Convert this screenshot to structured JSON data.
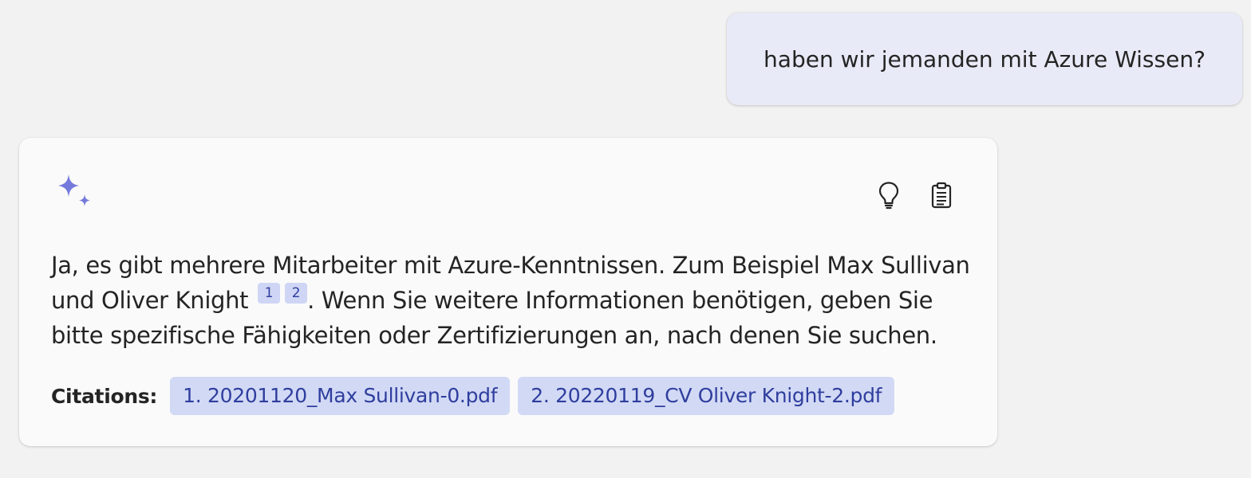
{
  "user_message": {
    "text": "haben wir jemanden mit Azure Wissen?"
  },
  "assistant_message": {
    "text_part1": "Ja, es gibt mehrere Mitarbeiter mit Azure-Kenntnissen. Zum Beispiel Max Sullivan und Oliver Knight",
    "refs": [
      "1",
      "2"
    ],
    "text_part2": ". Wenn Sie weitere Informationen benötigen, geben Sie bitte spezifische Fähigkeiten oder Zertifizierungen an, nach denen Sie suchen.",
    "citations_label": "Citations:",
    "citations": [
      "1. 20201120_Max Sullivan-0.pdf",
      "2. 20220119_CV Oliver Knight-2.pdf"
    ],
    "icons": [
      "sparkle-icon",
      "lightbulb-icon",
      "clipboard-icon"
    ]
  },
  "colors": {
    "background": "#f2f2f2",
    "user_bubble": "#e9eaf7",
    "card": "#fafafa",
    "accent": "#7479dc",
    "chip_bg": "#d2d9f5",
    "chip_text": "#2f3e9e"
  }
}
